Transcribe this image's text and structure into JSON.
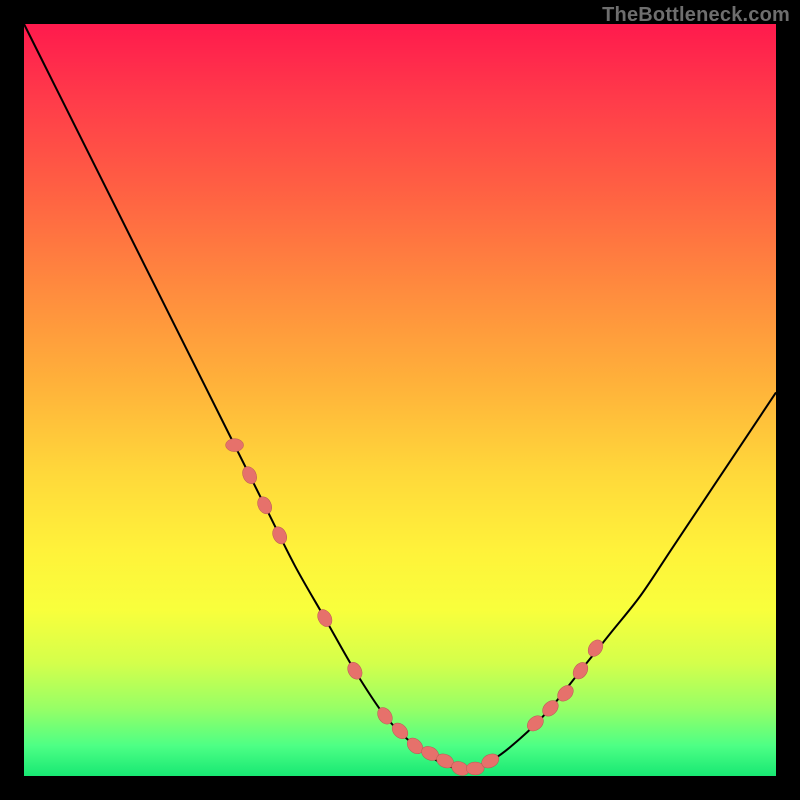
{
  "watermark": "TheBottleneck.com",
  "colors": {
    "page_bg": "#000000",
    "bead_fill": "#e6716b",
    "bead_stroke": "#b85a55",
    "curve_stroke": "#000000",
    "gradient_top": "#ff1a4d",
    "gradient_bottom": "#18e873"
  },
  "chart_data": {
    "type": "line",
    "title": "",
    "xlabel": "",
    "ylabel": "",
    "xlim": [
      0,
      100
    ],
    "ylim": [
      0,
      100
    ],
    "grid": false,
    "legend": false,
    "series": [
      {
        "name": "bottleneck-curve",
        "x": [
          0,
          4,
          8,
          12,
          16,
          20,
          24,
          28,
          32,
          36,
          40,
          44,
          48,
          52,
          55,
          58,
          62,
          66,
          70,
          74,
          78,
          82,
          86,
          90,
          94,
          98,
          100
        ],
        "y": [
          100,
          92,
          84,
          76,
          68,
          60,
          52,
          44,
          36,
          28,
          21,
          14,
          8,
          4,
          2,
          1,
          2,
          5,
          9,
          14,
          19,
          24,
          30,
          36,
          42,
          48,
          51
        ]
      }
    ],
    "markers": {
      "name": "highlight-beads",
      "x": [
        28,
        30,
        32,
        34,
        40,
        44,
        48,
        50,
        52,
        54,
        56,
        58,
        60,
        62,
        68,
        70,
        72,
        74,
        76
      ],
      "y": [
        44,
        40,
        36,
        32,
        21,
        14,
        8,
        6,
        4,
        3,
        2,
        1,
        1,
        2,
        7,
        9,
        11,
        14,
        17
      ]
    }
  }
}
